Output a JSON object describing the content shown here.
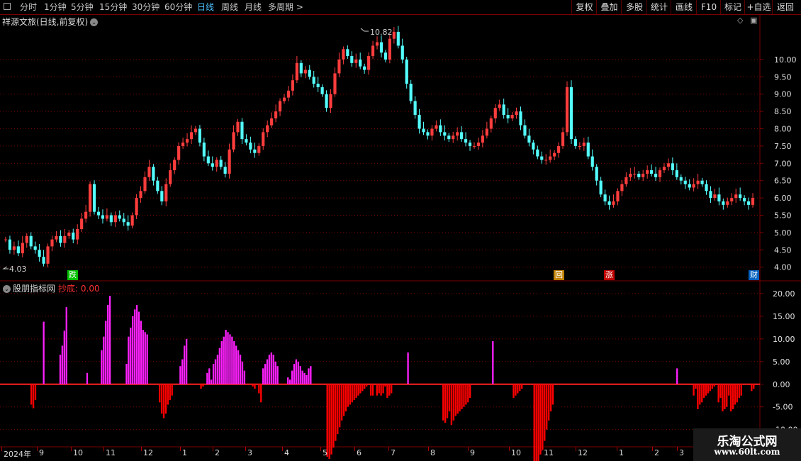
{
  "toolbar": {
    "periods": [
      "分时",
      "1分钟",
      "5分钟",
      "15分钟",
      "30分钟",
      "60分钟",
      "日线",
      "周线",
      "月线",
      "多周期 >"
    ],
    "selected_period": "日线",
    "right_buttons": [
      "复权",
      "叠加",
      "多股",
      "统计",
      "画线",
      "F10",
      "标记",
      "+自选",
      "返回"
    ]
  },
  "stock": {
    "title": "祥源文旅(日线,前复权)",
    "high_label": "10.82",
    "low_label": "4.03"
  },
  "indicator": {
    "title": "股朋指标网",
    "value_label": "抄底: 0.00"
  },
  "events": [
    {
      "label": "跌",
      "color": "#00c000"
    },
    {
      "label": "回",
      "color": "#c08000"
    },
    {
      "label": "涨",
      "color": "#c00000"
    },
    {
      "label": "财",
      "color": "#0060c0"
    }
  ],
  "date_axis": [
    "2024年",
    "9",
    "10",
    "11",
    "12",
    "1",
    "2",
    "3",
    "4",
    "5",
    "6",
    "7",
    "8",
    "9",
    "10",
    "11",
    "12",
    "1",
    "2",
    "3"
  ],
  "watermark": {
    "line1": "乐淘公式网",
    "line2": "www.60lt.com"
  },
  "colors": {
    "up": "#ff3d3d",
    "down": "#54ffff",
    "pos": "#ff20ff",
    "neg": "#ff0000",
    "grid": "#7a0000"
  },
  "chart_data": [
    {
      "type": "line",
      "ylim": [
        3.85,
        10.9
      ],
      "yticks": [
        "10.00",
        "9.50",
        "9.00",
        "8.50",
        "8.00",
        "7.50",
        "7.00",
        "6.50",
        "6.00",
        "5.50",
        "5.00",
        "4.50",
        "4.00"
      ],
      "series": [
        {
          "values": [
            4.8,
            4.5,
            4.6,
            4.4,
            4.7,
            4.9,
            4.6,
            4.5,
            4.3,
            4.1,
            4.6,
            4.8,
            4.9,
            4.7,
            4.9,
            5.0,
            4.8,
            5.1,
            5.4,
            5.6,
            6.4,
            5.6,
            5.5,
            5.4,
            5.5,
            5.3,
            5.5,
            5.4,
            5.3,
            5.2,
            5.5,
            6.0,
            6.2,
            6.6,
            6.9,
            6.5,
            6.2,
            5.9,
            6.4,
            6.8,
            7.1,
            7.5,
            7.6,
            7.7,
            7.9,
            8.0,
            7.6,
            7.2,
            7.0,
            6.9,
            7.1,
            6.9,
            6.7,
            7.4,
            7.9,
            8.2,
            7.7,
            7.6,
            7.4,
            7.3,
            7.5,
            7.9,
            8.1,
            8.3,
            8.5,
            8.8,
            8.9,
            9.1,
            9.4,
            9.9,
            9.6,
            9.7,
            9.5,
            9.3,
            9.2,
            9.0,
            8.6,
            9.0,
            9.6,
            10.0,
            10.3,
            10.1,
            9.9,
            10.0,
            9.8,
            9.7,
            10.1,
            10.4,
            10.5,
            10.2,
            10.0,
            10.6,
            10.8,
            10.4,
            10.0,
            9.3,
            8.8,
            8.4,
            8.0,
            7.9,
            7.8,
            8.0,
            8.1,
            7.9,
            7.8,
            7.7,
            7.8,
            7.9,
            7.7,
            7.6,
            7.5,
            7.5,
            7.6,
            7.8,
            8.0,
            8.3,
            8.6,
            8.7,
            8.4,
            8.3,
            8.4,
            8.5,
            8.1,
            7.8,
            7.6,
            7.4,
            7.2,
            7.1,
            7.1,
            7.2,
            7.3,
            7.5,
            7.9,
            9.2,
            7.7,
            7.5,
            7.5,
            7.6,
            7.2,
            6.9,
            6.5,
            6.1,
            5.9,
            5.8,
            5.9,
            6.2,
            6.4,
            6.6,
            6.7,
            6.7,
            6.6,
            6.7,
            6.8,
            6.7,
            6.6,
            6.8,
            6.9,
            7.0,
            6.8,
            6.6,
            6.5,
            6.4,
            6.3,
            6.4,
            6.5,
            6.4,
            6.2,
            6.0,
            6.1,
            5.9,
            5.8,
            5.9,
            6.0,
            6.1,
            6.0,
            5.9,
            5.8,
            6.0
          ]
        }
      ]
    },
    {
      "type": "bar",
      "ylim": [
        -13.5,
        22.5
      ],
      "yticks": [
        "20.00",
        "15.00",
        "10.00",
        "5.00",
        "0.00",
        "-5.00",
        "-10.00"
      ],
      "series": [
        {
          "values": [
            0,
            0,
            0,
            0,
            0,
            0,
            0,
            0,
            0,
            0,
            0,
            0,
            0,
            -4.5,
            -5.3,
            -3.5,
            0,
            0,
            0,
            13.8,
            0,
            0,
            0,
            0,
            0,
            0,
            0,
            6.5,
            8.5,
            11.8,
            17.0,
            0,
            0,
            0,
            0,
            0,
            0,
            0,
            0,
            0,
            2.5,
            0,
            0,
            0,
            0,
            0,
            0,
            7.5,
            10.5,
            14.0,
            17.5,
            19.5,
            0,
            0,
            0,
            0,
            0,
            0,
            0,
            4.5,
            10.5,
            12.5,
            15.0,
            16.5,
            17.5,
            16.0,
            14.0,
            12.0,
            11.5,
            11.0,
            0,
            0,
            0,
            0,
            0,
            -4.0,
            -6.5,
            -7.5,
            -6.5,
            -4.5,
            -3.5,
            -2.5,
            0,
            0,
            0,
            4.0,
            5.5,
            8.5,
            10.0,
            0,
            0,
            0,
            0,
            0,
            0,
            -1.0,
            -0.5,
            0,
            2.5,
            3.5,
            1.0,
            4.5,
            5.5,
            6.5,
            8.0,
            9.5,
            10.5,
            12.0,
            11.5,
            11.0,
            10.5,
            9.5,
            8.5,
            7.5,
            6.5,
            5.0,
            3.0,
            0,
            0,
            0,
            -0.5,
            -1.0,
            0,
            -2.0,
            -4.0,
            3.5,
            4.5,
            5.5,
            6.5,
            7.0,
            6.5,
            5.0,
            4.0,
            0,
            0,
            0,
            0,
            1.5,
            1.0,
            3.0,
            4.5,
            5.5,
            5.0,
            4.0,
            3.0,
            2.5,
            2.0,
            3.5,
            4.0,
            0,
            0,
            0,
            0,
            0,
            0,
            0,
            -16.0,
            -16.5,
            -15.5,
            -14.0,
            -12.5,
            -11.0,
            -9.5,
            -8.0,
            -7.0,
            -6.0,
            -5.0,
            -4.5,
            -4.0,
            -3.5,
            -3.0,
            -2.5,
            -2.0,
            -1.5,
            -1.0,
            -0.5,
            0,
            -2.5,
            -2.5,
            0,
            -2.5,
            -2.0,
            -2.5,
            -2.0,
            -0.5,
            -3.0,
            -2.5,
            -2.0,
            0,
            0,
            0,
            0,
            0,
            0,
            0,
            7.0,
            0,
            0,
            0,
            0,
            0,
            0,
            0,
            0,
            0,
            0,
            0,
            0,
            0,
            0,
            0,
            0,
            -8.0,
            -8.5,
            -7.5,
            -6.0,
            -9.0,
            -8.0,
            -7.0,
            -6.5,
            -6.0,
            -5.5,
            -5.0,
            -4.5,
            -4.0,
            -3.0,
            0,
            0,
            0,
            0,
            0,
            0,
            0,
            0,
            0,
            0,
            9.5,
            0,
            0,
            0,
            0,
            0,
            0,
            0,
            0,
            0,
            -3.0,
            -2.5,
            -2.0,
            -1.5,
            -1.0,
            0,
            0,
            0,
            0,
            0,
            -17.5,
            -18.0,
            -17.0,
            -15.5,
            -14.5,
            -12.5,
            -10.0,
            -8.0,
            -6.0,
            -4.5,
            0,
            0,
            0,
            0,
            0,
            0,
            0,
            0,
            0,
            0,
            0,
            0,
            0,
            0,
            0,
            0,
            0,
            0,
            0,
            0,
            0,
            0,
            0,
            0,
            0,
            0,
            0,
            0,
            0,
            0,
            0,
            0,
            0,
            0,
            0,
            0,
            0,
            0,
            0,
            0,
            0,
            0,
            0,
            0,
            0,
            0,
            0,
            0,
            0,
            0,
            0,
            0,
            0,
            0,
            0,
            0,
            0,
            0,
            0,
            3.5,
            0,
            0,
            0,
            0,
            0,
            0,
            0,
            -2.5,
            -1.0,
            -5.5,
            -4.5,
            -4.0,
            -3.0,
            -2.5,
            -2.0,
            -1.5,
            -1.0,
            -0.5,
            0,
            -4.0,
            -3.0,
            -6.0,
            -5.5,
            -5.0,
            -2.5,
            -6.0,
            -5.5,
            -4.5,
            -4.0,
            -3.0,
            -2.5,
            0,
            0,
            0,
            0,
            -1.5,
            -1.0
          ]
        }
      ]
    }
  ]
}
